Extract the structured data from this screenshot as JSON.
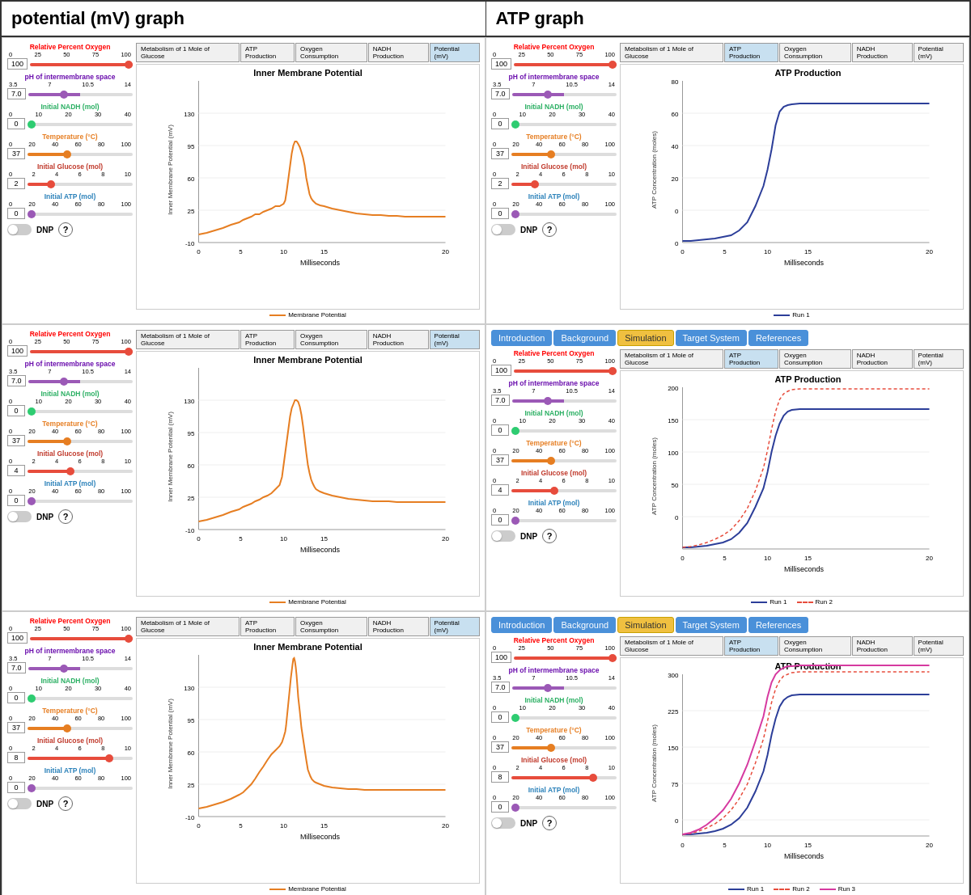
{
  "headers": {
    "left": "potential (mV) graph",
    "right": "ATP graph"
  },
  "navTabs": [
    "Introduction",
    "Background",
    "Simulation",
    "Target System",
    "References"
  ],
  "graphTabs": [
    "Metabolism of 1 Mole of Glucose",
    "ATP Production",
    "Oxygen Consumption",
    "NADH Production",
    "Potential (mV)"
  ],
  "controls": {
    "relativeO2": {
      "label": "Relative Percent Oxygen",
      "marks": [
        "0",
        "25",
        "50",
        "75",
        "100"
      ],
      "values": [
        [
          "row1_left",
          "100"
        ],
        [
          "row1_right",
          "100"
        ],
        [
          "row2_left",
          "100"
        ],
        [
          "row2_right",
          "100"
        ],
        [
          "row3_left",
          "100"
        ],
        [
          "row3_right",
          "100"
        ]
      ]
    },
    "pH": {
      "label": "pH of intermembrane space",
      "marks": [
        "3.5",
        "7",
        "10.5",
        "14"
      ],
      "values": [
        "7.0",
        "7.0",
        "7.0",
        "7.0",
        "7.0",
        "7.0"
      ]
    },
    "NADH": {
      "label": "Initial NADH (mol)",
      "marks": [
        "0",
        "10",
        "20",
        "30",
        "40"
      ],
      "values": [
        "0",
        "0",
        "0",
        "0",
        "0",
        "0"
      ]
    },
    "temp": {
      "label": "Temperature (°C)",
      "marks": [
        "0",
        "20",
        "40",
        "60",
        "80",
        "100"
      ],
      "values": [
        "37",
        "37",
        "37",
        "37",
        "37",
        "37"
      ]
    },
    "glucose": {
      "label": "Initial Glucose (mol)",
      "marks": [
        "0",
        "2",
        "4",
        "6",
        "8",
        "10"
      ],
      "values": [
        "2",
        "2",
        "4",
        "4",
        "8",
        "8"
      ]
    },
    "ATP": {
      "label": "Initial ATP (mol)",
      "marks": [
        "0",
        "20",
        "40",
        "60",
        "80",
        "100"
      ],
      "values": [
        "0",
        "0",
        "0",
        "0",
        "0",
        "0"
      ]
    }
  },
  "charts": {
    "r1l": {
      "title": "Inner Membrane Potential",
      "xLabel": "Milliseconds",
      "yLabel": "Inner Membrane Potential (mV)",
      "legend": "Membrane Potential"
    },
    "r1r": {
      "title": "ATP Production",
      "xLabel": "Milliseconds",
      "yLabel": "ATP Concentration (moles)",
      "legend": "Run 1"
    },
    "r2l": {
      "title": "Inner Membrane Potential",
      "xLabel": "Milliseconds",
      "yLabel": "Inner Membrane Potential (mV)",
      "legend": "Membrane Potential"
    },
    "r2r": {
      "title": "ATP Production",
      "xLabel": "Milliseconds",
      "yLabel": "ATP Concentration (moles)",
      "legends": [
        "Run 1",
        "Run 2"
      ]
    },
    "r3l": {
      "title": "Inner Membrane Potential",
      "xLabel": "Milliseconds",
      "yLabel": "Inner Membrane Potential (mV)",
      "legend": "Membrane Potential"
    },
    "r3r": {
      "title": "ATP Production",
      "xLabel": "Milliseconds",
      "yLabel": "ATP Concentration (moles)",
      "legends": [
        "Run 1",
        "Run 2",
        "Run 3"
      ]
    }
  }
}
